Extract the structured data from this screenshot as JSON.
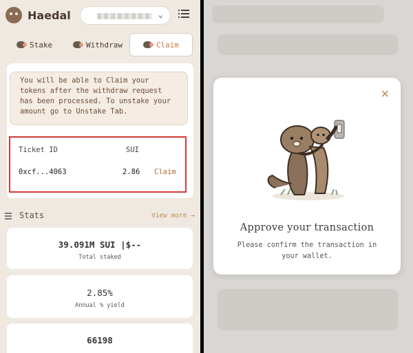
{
  "app": {
    "name": "Haedal"
  },
  "tabs": [
    {
      "label": "Stake"
    },
    {
      "label": "Withdraw"
    },
    {
      "label": "Claim"
    }
  ],
  "claim": {
    "info": "You will be able to Claim your tokens after the withdraw request has been processed. To unstake your amount go to Unstake Tab.",
    "columns": {
      "ticket": "Ticket ID",
      "sui": "SUI"
    },
    "row": {
      "ticket_id": "0xcf...4063",
      "amount": "2.86",
      "action": "Claim"
    }
  },
  "stats": {
    "title": "Stats",
    "view_more": "View more →",
    "items": [
      {
        "value": "39.091M SUI |$--",
        "label": "Total staked"
      },
      {
        "value": "2.85%",
        "label": "Annual % yield"
      },
      {
        "value": "66198",
        "label": ""
      }
    ]
  },
  "modal": {
    "title": "Approve your transaction",
    "subtitle": "Please confirm the transaction in your wallet."
  },
  "colors": {
    "accent": "#c87a40",
    "highlight_border": "#d23b35",
    "background": "#efe9e2"
  },
  "icons": [
    "haedal-logo-icon",
    "chevron-down-icon",
    "menu-icon",
    "stake-icon",
    "withdraw-icon",
    "claim-icon",
    "stats-icon",
    "close-icon"
  ]
}
